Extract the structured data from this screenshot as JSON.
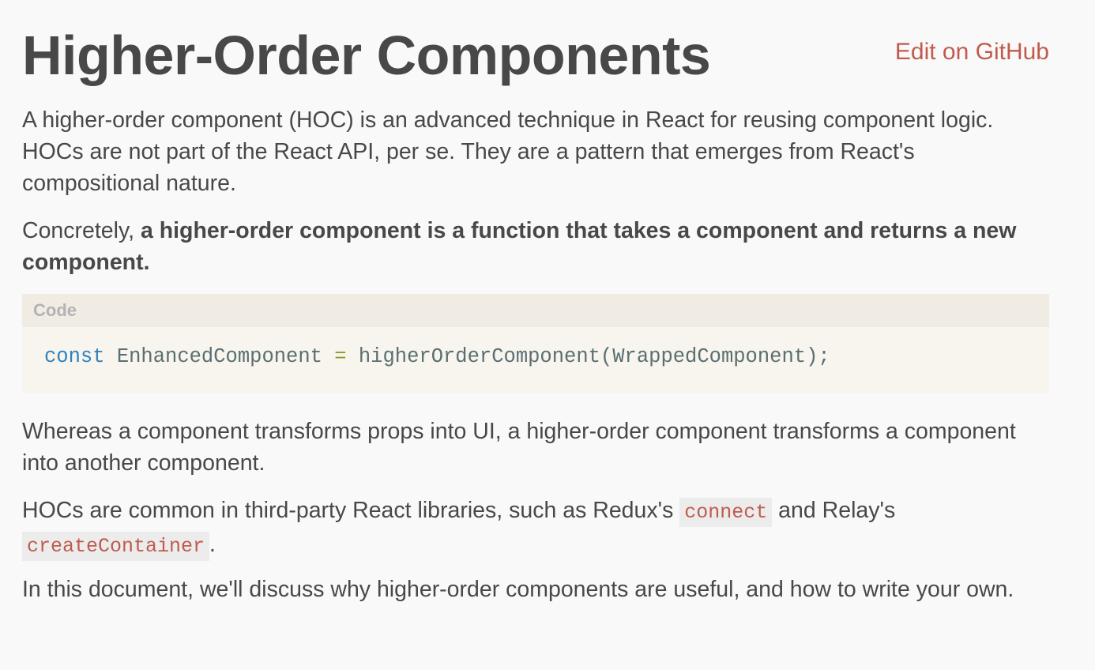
{
  "header": {
    "title": "Higher-Order Components",
    "edit_link": "Edit on GitHub"
  },
  "paragraphs": {
    "p1": "A higher-order component (HOC) is an advanced technique in React for reusing component logic. HOCs are not part of the React API, per se. They are a pattern that emerges from React's compositional nature.",
    "p2_prefix": "Concretely, ",
    "p2_bold": "a higher-order component is a function that takes a component and returns a new component.",
    "p3": "Whereas a component transforms props into UI, a higher-order component transforms a component into another component.",
    "p4_prefix": "HOCs are common in third-party React libraries, such as Redux's ",
    "p4_code1": "connect",
    "p4_middle": " and Relay's ",
    "p4_code2": "createContainer",
    "p4_suffix": ".",
    "p5": "In this document, we'll discuss why higher-order components are useful, and how to write your own."
  },
  "code_block": {
    "header": "Code",
    "keyword": "const",
    "var_name": " EnhancedComponent ",
    "operator": "=",
    "expression": " higherOrderComponent(WrappedComponent);"
  },
  "colors": {
    "link": "#c05b4d",
    "text": "#484848",
    "background": "#f9f9f9",
    "code_keyword": "#2f81bf",
    "code_operator": "#8a9a2b"
  }
}
